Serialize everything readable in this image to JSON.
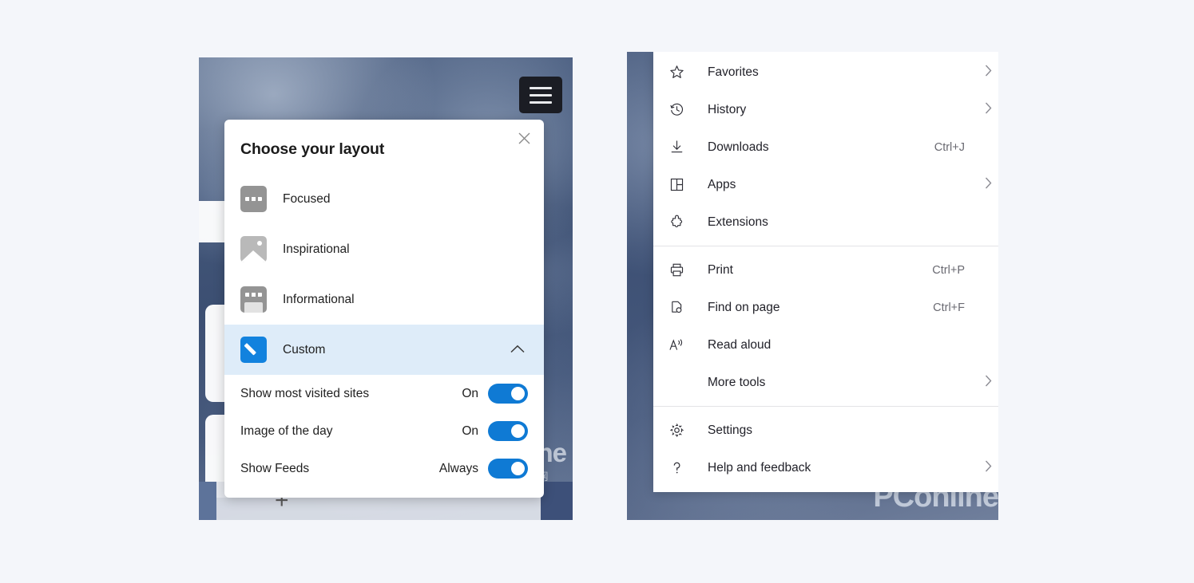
{
  "background_color": "#f4f6fa",
  "accent_color": "#0f7ad4",
  "highlight_color": "#deecf9",
  "left_panel": {
    "hamburger": {
      "icon": "hamburger-icon"
    },
    "plus_button": "+",
    "dialog": {
      "title": "Choose your layout",
      "close_icon": "close-icon",
      "options": [
        {
          "label": "Focused",
          "icon": "focused-layout-icon",
          "selected": false,
          "chevron": ""
        },
        {
          "label": "Inspirational",
          "icon": "inspirational-layout-icon",
          "selected": false,
          "chevron": ""
        },
        {
          "label": "Informational",
          "icon": "informational-layout-icon",
          "selected": false,
          "chevron": ""
        },
        {
          "label": "Custom",
          "icon": "custom-layout-icon",
          "selected": true,
          "chevron": "chevron-up-icon"
        }
      ],
      "settings": [
        {
          "label": "Show most visited sites",
          "state": "On",
          "toggle": "on"
        },
        {
          "label": "Image of the day",
          "state": "On",
          "toggle": "on"
        },
        {
          "label": "Show Feeds",
          "state": "Always",
          "toggle": "on"
        }
      ]
    },
    "watermark": {
      "main": "PConline",
      "cn": "太平洋电脑网"
    }
  },
  "right_panel": {
    "watermark": "PConline",
    "menu": [
      {
        "label": "Favorites",
        "icon": "star-icon",
        "shortcut": "",
        "submenu": true
      },
      {
        "label": "History",
        "icon": "history-icon",
        "shortcut": "",
        "submenu": true
      },
      {
        "label": "Downloads",
        "icon": "download-icon",
        "shortcut": "Ctrl+J",
        "submenu": false
      },
      {
        "label": "Apps",
        "icon": "apps-grid-icon",
        "shortcut": "",
        "submenu": true
      },
      {
        "label": "Extensions",
        "icon": "puzzle-icon",
        "shortcut": "",
        "submenu": false
      },
      {
        "separator": true
      },
      {
        "label": "Print",
        "icon": "printer-icon",
        "shortcut": "Ctrl+P",
        "submenu": false
      },
      {
        "label": "Find on page",
        "icon": "find-page-icon",
        "shortcut": "Ctrl+F",
        "submenu": false
      },
      {
        "label": "Read aloud",
        "icon": "read-aloud-icon",
        "shortcut": "",
        "submenu": false
      },
      {
        "label": "More tools",
        "icon": "",
        "shortcut": "",
        "submenu": true
      },
      {
        "separator": true
      },
      {
        "label": "Settings",
        "icon": "gear-icon",
        "shortcut": "",
        "submenu": false
      },
      {
        "label": "Help and feedback",
        "icon": "question-icon",
        "shortcut": "",
        "submenu": true
      }
    ]
  }
}
